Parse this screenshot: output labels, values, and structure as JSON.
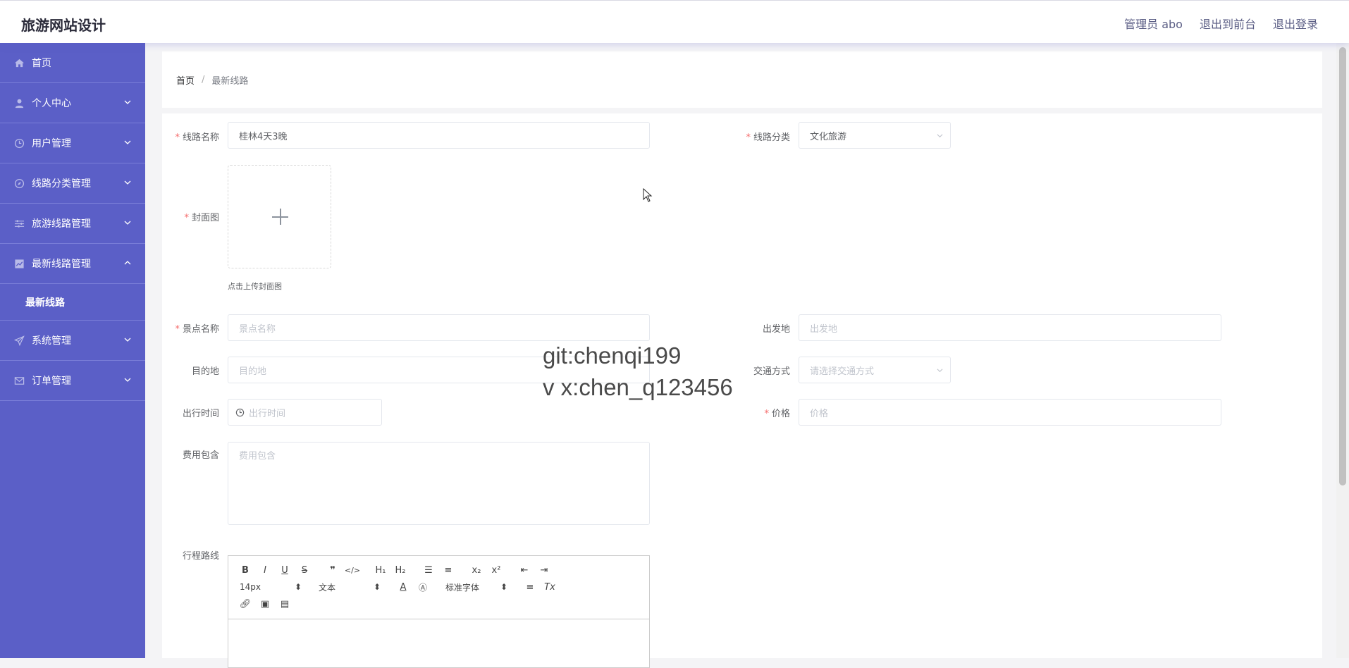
{
  "header": {
    "title": "旅游网站设计",
    "admin_label": "管理员 abo",
    "exit_front_label": "退出到前台",
    "logout_label": "退出登录"
  },
  "sidebar": {
    "items": [
      {
        "label": "首页",
        "icon": "home-icon"
      },
      {
        "label": "个人中心",
        "icon": "user-icon"
      },
      {
        "label": "用户管理",
        "icon": "clock-icon"
      },
      {
        "label": "线路分类管理",
        "icon": "compass-icon"
      },
      {
        "label": "旅游线路管理",
        "icon": "sliders-icon"
      },
      {
        "label": "最新线路管理",
        "icon": "chart-icon"
      },
      {
        "label": "系统管理",
        "icon": "send-icon"
      },
      {
        "label": "订单管理",
        "icon": "mail-icon"
      }
    ],
    "submenu_label": "最新线路"
  },
  "breadcrumb": {
    "home": "首页",
    "separator": "/",
    "current": "最新线路"
  },
  "form": {
    "route_name": {
      "label": "线路名称",
      "value": "桂林4天3晚"
    },
    "route_category": {
      "label": "线路分类",
      "value": "文化旅游"
    },
    "cover": {
      "label": "封面图",
      "tip": "点击上传封面图"
    },
    "scenic_name": {
      "label": "景点名称",
      "placeholder": "景点名称"
    },
    "departure": {
      "label": "出发地",
      "placeholder": "出发地"
    },
    "destination": {
      "label": "目的地",
      "placeholder": "目的地"
    },
    "transport": {
      "label": "交通方式",
      "placeholder": "请选择交通方式"
    },
    "travel_time": {
      "label": "出行时间",
      "placeholder": "出行时间"
    },
    "price": {
      "label": "价格",
      "placeholder": "价格"
    },
    "fee_includes": {
      "label": "费用包含",
      "placeholder": "费用包含"
    },
    "itinerary": {
      "label": "行程路线"
    }
  },
  "editor": {
    "font_size": "14px",
    "text_type": "文本",
    "font_family": "标准字体"
  },
  "watermark": {
    "line1": "git:chenqi199",
    "line2": "v x:chen_q123456"
  },
  "colors": {
    "sidebar_bg": "#5b5fc7",
    "required": "#f56c6c",
    "header_link": "#5b5e85"
  }
}
